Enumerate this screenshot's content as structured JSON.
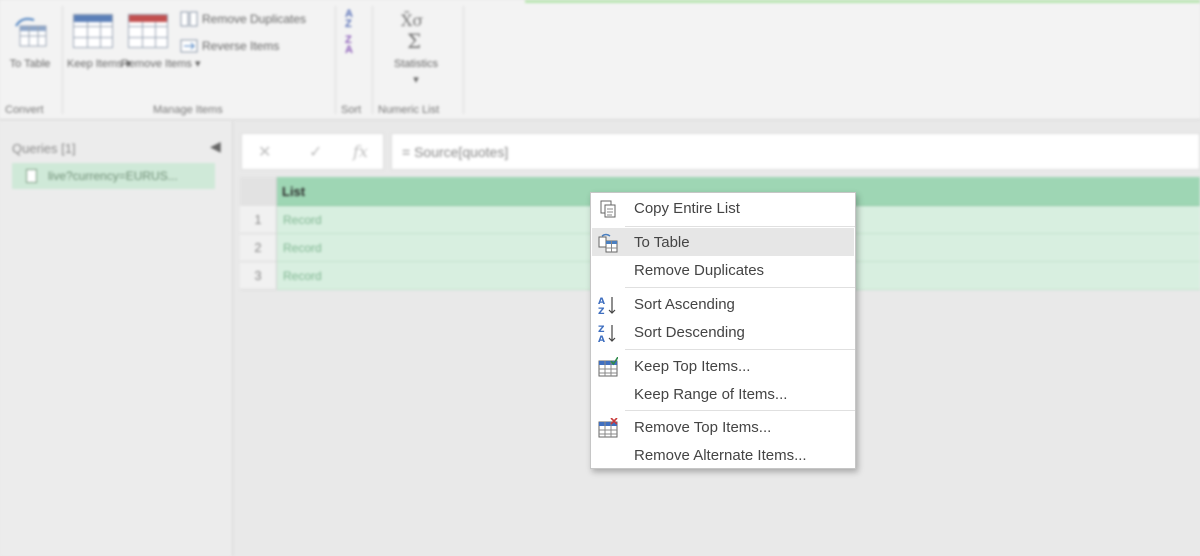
{
  "ribbon": {
    "to_table_label": "To Table",
    "convert_group": "Convert",
    "keep_items_label": "Keep Items",
    "remove_items_label": "Remove Items",
    "remove_duplicates_label": "Remove Duplicates",
    "reverse_items_label": "Reverse Items",
    "manage_items_group": "Manage Items",
    "sort_group": "Sort",
    "statistics_label": "Statistics",
    "numeric_list_group": "Numeric List",
    "dropdown_glyph": "▾",
    "accent_color": "#b9e6b0"
  },
  "queries": {
    "title": "Queries [1]",
    "collapse_glyph": "◀",
    "items": [
      {
        "label": "live?currency=EURUS..."
      }
    ]
  },
  "formula_bar": {
    "cancel_glyph": "✕",
    "commit_glyph": "✓",
    "fx_glyph": "fx",
    "formula": "= Source[quotes]"
  },
  "grid": {
    "column_header": "List",
    "header_color": "#9ed6b4",
    "rows": [
      {
        "num": "1",
        "value": "Record"
      },
      {
        "num": "2",
        "value": "Record"
      },
      {
        "num": "3",
        "value": "Record"
      }
    ]
  },
  "context_menu": {
    "items": {
      "copy_entire_list": {
        "label": "Copy Entire List",
        "icon": "copy-icon"
      },
      "to_table": {
        "label": "To Table",
        "icon": "to-table-icon"
      },
      "remove_duplicates": {
        "label": "Remove Duplicates"
      },
      "sort_ascending": {
        "label": "Sort Ascending",
        "icon": "sort-ascending-icon"
      },
      "sort_descending": {
        "label": "Sort Descending",
        "icon": "sort-descending-icon"
      },
      "keep_top_items": {
        "label": "Keep Top Items...",
        "icon": "keep-rows-icon"
      },
      "keep_range_of_items": {
        "label": "Keep Range of Items..."
      },
      "remove_top_items": {
        "label": "Remove Top Items...",
        "icon": "remove-rows-icon"
      },
      "remove_alternate_items": {
        "label": "Remove Alternate Items..."
      }
    },
    "hovered_item": "To Table"
  }
}
